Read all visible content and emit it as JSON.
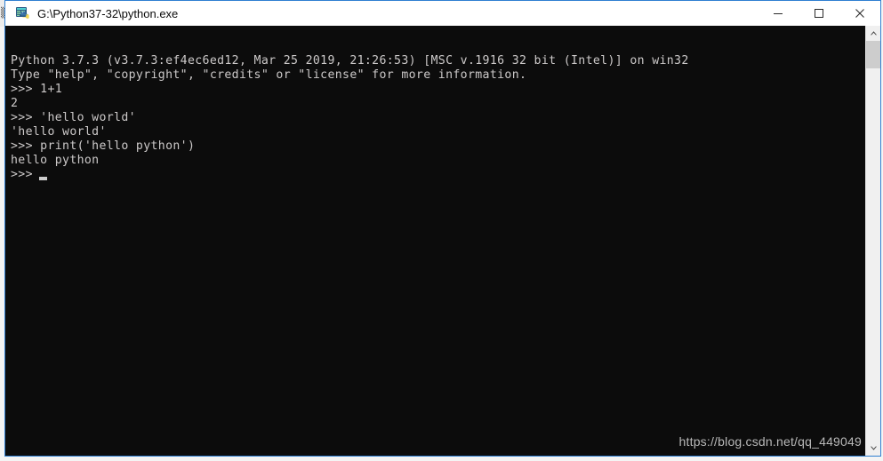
{
  "window": {
    "title": "G:\\Python37-32\\python.exe",
    "icon": "python-console-icon",
    "accent_color": "#2f7fd1",
    "controls": {
      "minimize": "minimize-icon",
      "maximize": "maximize-icon",
      "close": "close-icon"
    }
  },
  "desktop": {
    "fragment_glyph": "▒"
  },
  "console": {
    "background_color": "#0c0c0c",
    "text_color": "#cccccc",
    "lines": [
      "Python 3.7.3 (v3.7.3:ef4ec6ed12, Mar 25 2019, 21:26:53) [MSC v.1916 32 bit (Intel)] on win32",
      "Type \"help\", \"copyright\", \"credits\" or \"license\" for more information.",
      ">>> 1+1",
      "2",
      ">>> 'hello world'",
      "'hello world'",
      ">>> print('hello python')",
      "hello python",
      ">>> "
    ],
    "prompt": ">>>",
    "cursor": "block-cursor"
  },
  "watermark": {
    "text": "https://blog.csdn.net/qq_449049"
  },
  "scrollbar": {
    "up_arrow": "chevron-up-icon",
    "down_arrow": "chevron-down-icon",
    "thumb": "scrollbar-thumb"
  }
}
